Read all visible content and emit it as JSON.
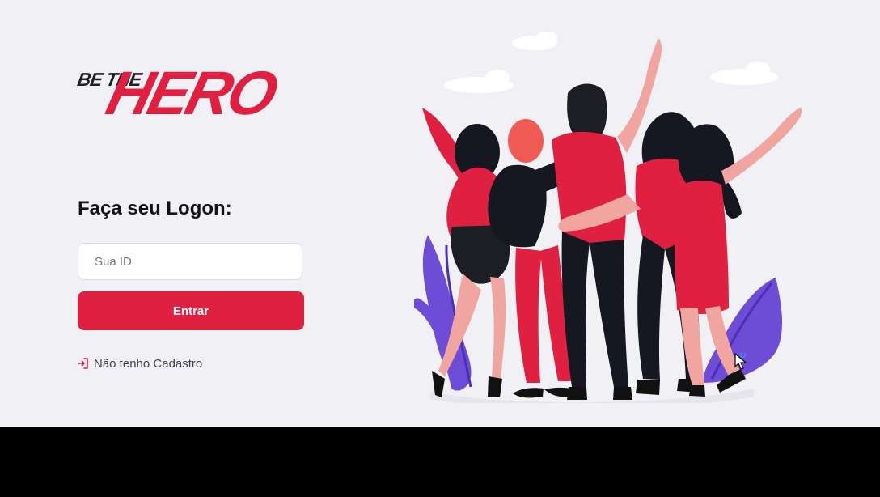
{
  "brand": {
    "logo_small": "BE THE",
    "logo_hero": "HERO"
  },
  "form": {
    "title": "Faça seu Logon:",
    "id_placeholder": "Sua ID",
    "id_value": "",
    "enter_label": "Entrar",
    "register_label": "Não tenho Cadastro",
    "register_icon": "log-in-icon"
  },
  "colors": {
    "accent": "#e02041",
    "background": "#f0f0f5",
    "text": "#13131a",
    "link_text": "#41414d",
    "illustration_purple": "#6f4cd6"
  },
  "illustration": {
    "semantic_name": "heroes-group-illustration"
  }
}
